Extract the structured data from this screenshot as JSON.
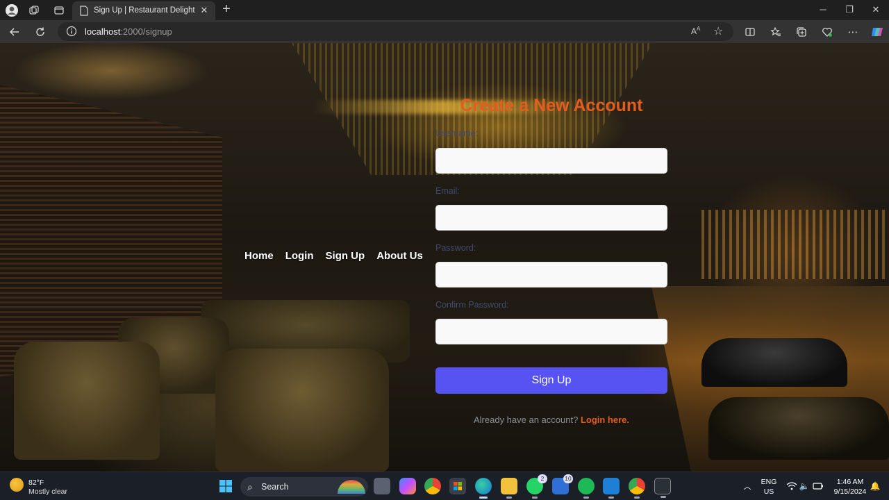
{
  "browser": {
    "tab_title": "Sign Up | Restaurant Delight",
    "url_host": "localhost",
    "url_rest": ":2000/signup"
  },
  "nav": {
    "items": [
      "Home",
      "Login",
      "Sign Up",
      "About Us"
    ]
  },
  "form": {
    "title": "Create a New Account",
    "username_label": "Username:",
    "email_label": "Email:",
    "password_label": "Password:",
    "confirm_label": "Confirm Password:",
    "submit_label": "Sign Up",
    "login_prompt": "Already have an account?",
    "login_link": "Login here."
  },
  "taskbar": {
    "weather_temp": "82°F",
    "weather_desc": "Mostly clear",
    "search_label": "Search",
    "whatsapp_badge": "2",
    "teams_badge": "10",
    "lang_top": "ENG",
    "lang_bottom": "US",
    "time": "1:46 AM",
    "date": "9/15/2024"
  },
  "colors": {
    "accent_orange": "#e35d1f",
    "button_purple": "#5753f2",
    "label_text": "#3f4a6e"
  }
}
